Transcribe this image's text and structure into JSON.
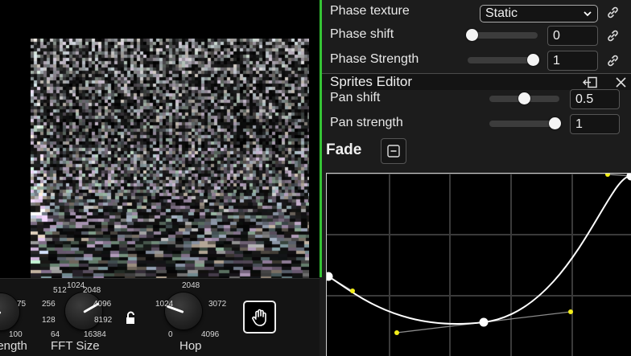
{
  "knobs": {
    "length": {
      "label": "Length",
      "ticks": [
        "75",
        "100"
      ]
    },
    "fft_size": {
      "label": "FFT Size",
      "ticks": [
        "512",
        "1024",
        "2048",
        "256",
        "4096",
        "128",
        "8192",
        "64",
        "16384"
      ]
    },
    "hop": {
      "label": "Hop",
      "ticks": [
        "2048",
        "1024",
        "3072",
        "0",
        "4096"
      ]
    }
  },
  "phase": {
    "texture_label": "Phase texture",
    "texture_value": "Static",
    "shift_label": "Phase shift",
    "shift_value": "0",
    "shift_fraction": 0.0,
    "strength_label": "Phase Strength",
    "strength_value": "1",
    "strength_fraction": 1.0
  },
  "sprites_editor": {
    "title": "Sprites Editor",
    "pan_shift_label": "Pan shift",
    "pan_shift_value": "0.5",
    "pan_shift_fraction": 0.5,
    "pan_strength_label": "Pan strength",
    "pan_strength_value": "1",
    "pan_strength_fraction": 1.0
  },
  "fade": {
    "title": "Fade"
  },
  "colors": {
    "accent_green": "#35c435",
    "handle_yellow": "#f2ee1a",
    "panel_bg": "#1c1c1c"
  },
  "icons": [
    "lock-open-icon",
    "hand-grab-icon",
    "link-icon",
    "chevron-down-icon",
    "dock-icon",
    "close-icon",
    "collapse-minus-icon"
  ]
}
